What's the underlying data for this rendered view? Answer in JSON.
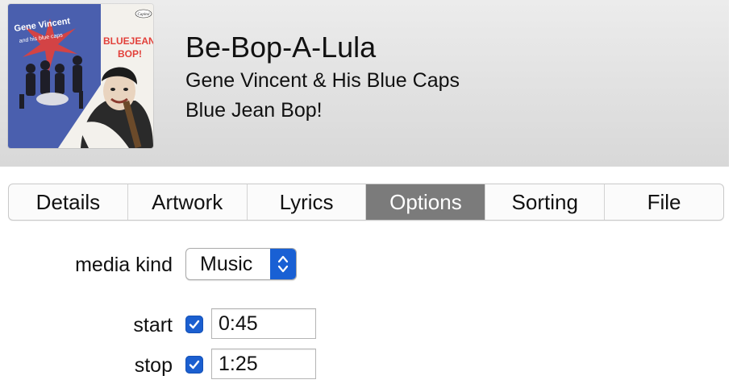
{
  "track": {
    "title": "Be-Bop-A-Lula",
    "artist": "Gene Vincent & His Blue Caps",
    "album": "Blue Jean Bop!"
  },
  "artwork": {
    "icon": "album-artwork",
    "artist_text_1": "Gene Vincent",
    "artist_text_2": "and his blue caps",
    "title_text_1": "BLUEJEAN",
    "title_text_2": "BOP!",
    "label_text": "Capitol",
    "colors": {
      "blue": "#4a5fae",
      "white": "#f3f1ec",
      "red": "#e2403a"
    }
  },
  "tabs": [
    {
      "label": "Details",
      "active": false
    },
    {
      "label": "Artwork",
      "active": false
    },
    {
      "label": "Lyrics",
      "active": false
    },
    {
      "label": "Options",
      "active": true
    },
    {
      "label": "Sorting",
      "active": false
    },
    {
      "label": "File",
      "active": false
    }
  ],
  "options": {
    "media_kind_label": "media kind",
    "media_kind_value": "Music",
    "start_label": "start",
    "start_checked": true,
    "start_value": "0:45",
    "stop_label": "stop",
    "stop_checked": true,
    "stop_value": "1:25"
  },
  "colors": {
    "accent": "#1960d4",
    "active_tab": "#7b7b7b",
    "header_bg": "#dcdcdc"
  }
}
